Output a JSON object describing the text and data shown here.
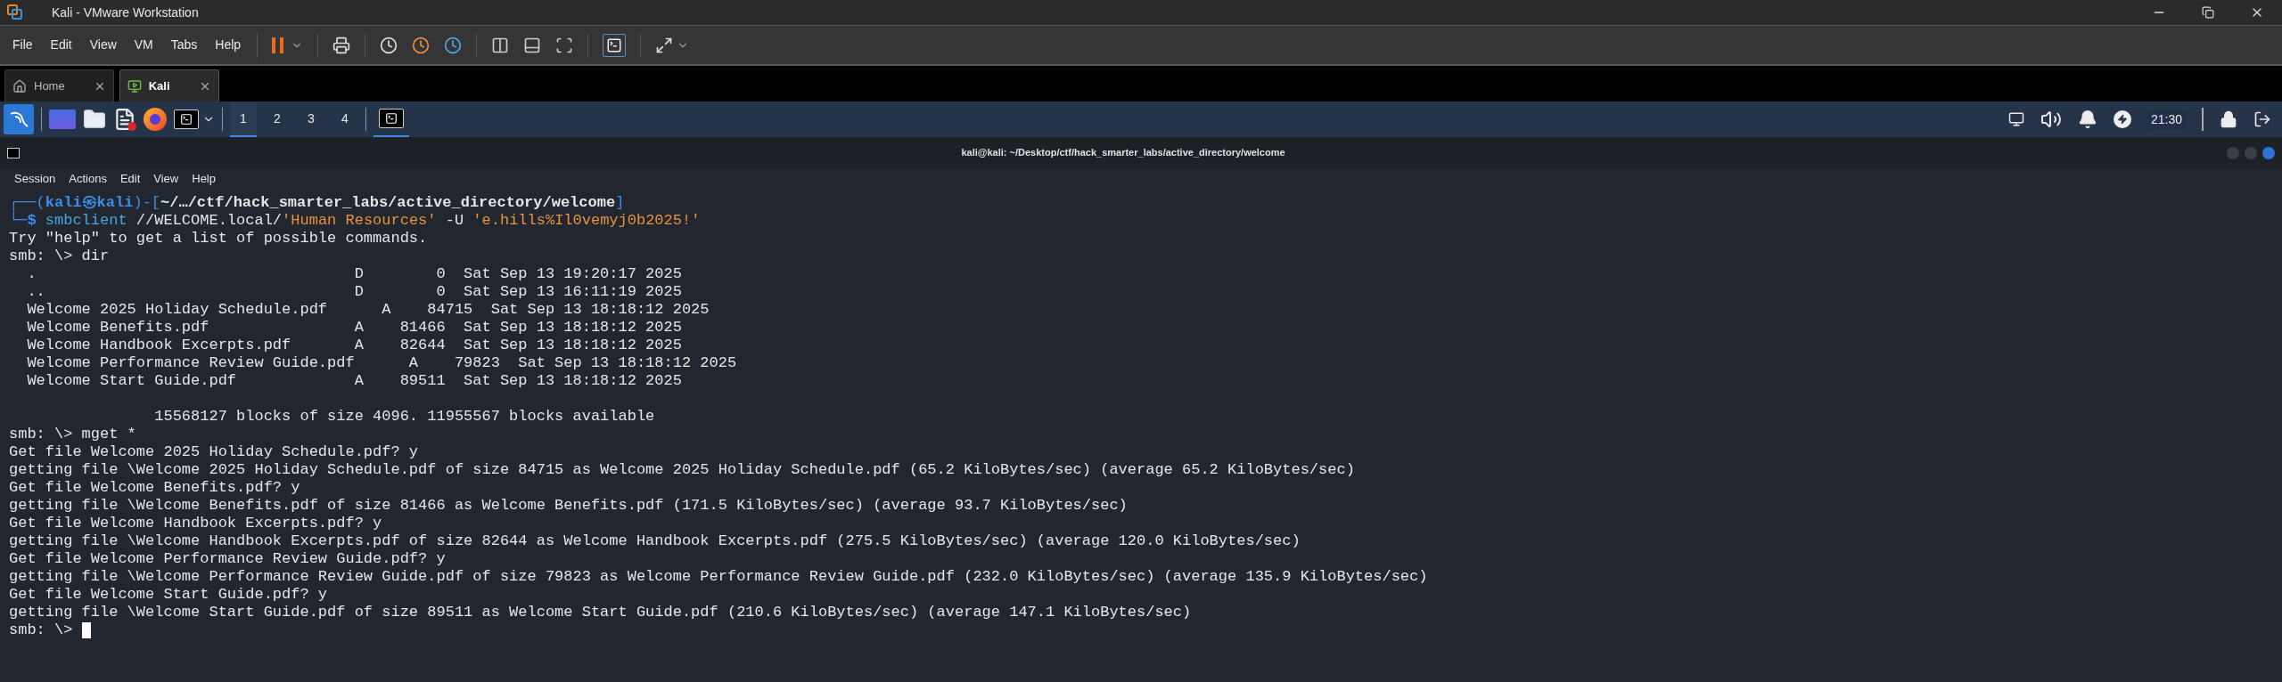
{
  "window": {
    "title": "Kali - VMware Workstation"
  },
  "menu": [
    "File",
    "Edit",
    "View",
    "VM",
    "Tabs",
    "Help"
  ],
  "vm_tabs": [
    {
      "label": "Home",
      "selected": false
    },
    {
      "label": "Kali",
      "selected": true
    }
  ],
  "panel": {
    "workspaces": [
      {
        "label": "1",
        "selected": true
      },
      {
        "label": "2",
        "selected": false
      },
      {
        "label": "3",
        "selected": false
      },
      {
        "label": "4",
        "selected": false
      }
    ],
    "clock": "21:30"
  },
  "terminal": {
    "title": "kali@kali: ~/Desktop/ctf/hack_smarter_labs/active_directory/welcome",
    "menu": [
      "Session",
      "Actions",
      "Edit",
      "View",
      "Help"
    ],
    "lines": [
      [
        {
          "kind": "frame",
          "text": "┌──("
        },
        {
          "kind": "user",
          "text": "kali㉿kali"
        },
        {
          "kind": "frame",
          "text": ")-["
        },
        {
          "kind": "path",
          "text": "~/…/ctf/hack_smarter_labs/active_directory/welcome"
        },
        {
          "kind": "frame",
          "text": "]"
        }
      ],
      [
        {
          "kind": "frame",
          "text": "└─"
        },
        {
          "kind": "user",
          "text": "$ "
        },
        {
          "kind": "command",
          "text": "smbclient"
        },
        {
          "kind": "plain",
          "text": " //WELCOME.local/"
        },
        {
          "kind": "string",
          "text": "'Human Resources'"
        },
        {
          "kind": "plain",
          "text": " -U "
        },
        {
          "kind": "string",
          "text": "'e.hills%Il0vemyj0b2025!'"
        }
      ],
      [
        {
          "kind": "plain",
          "text": "Try \"help\" to get a list of possible commands."
        }
      ],
      [
        {
          "kind": "plain",
          "text": "smb: \\> dir"
        }
      ],
      [
        {
          "kind": "plain",
          "text": "  .                                   D        0  Sat Sep 13 19:20:17 2025"
        }
      ],
      [
        {
          "kind": "plain",
          "text": "  ..                                  D        0  Sat Sep 13 16:11:19 2025"
        }
      ],
      [
        {
          "kind": "plain",
          "text": "  Welcome 2025 Holiday Schedule.pdf      A    84715  Sat Sep 13 18:18:12 2025"
        }
      ],
      [
        {
          "kind": "plain",
          "text": "  Welcome Benefits.pdf                A    81466  Sat Sep 13 18:18:12 2025"
        }
      ],
      [
        {
          "kind": "plain",
          "text": "  Welcome Handbook Excerpts.pdf       A    82644  Sat Sep 13 18:18:12 2025"
        }
      ],
      [
        {
          "kind": "plain",
          "text": "  Welcome Performance Review Guide.pdf      A    79823  Sat Sep 13 18:18:12 2025"
        }
      ],
      [
        {
          "kind": "plain",
          "text": "  Welcome Start Guide.pdf             A    89511  Sat Sep 13 18:18:12 2025"
        }
      ],
      [
        {
          "kind": "blank"
        }
      ],
      [
        {
          "kind": "plain",
          "text": "                15568127 blocks of size 4096. 11955567 blocks available"
        }
      ],
      [
        {
          "kind": "plain",
          "text": "smb: \\> mget *"
        }
      ],
      [
        {
          "kind": "plain",
          "text": "Get file Welcome 2025 Holiday Schedule.pdf? y"
        }
      ],
      [
        {
          "kind": "plain",
          "text": "getting file \\Welcome 2025 Holiday Schedule.pdf of size 84715 as Welcome 2025 Holiday Schedule.pdf (65.2 KiloBytes/sec) (average 65.2 KiloBytes/sec)"
        }
      ],
      [
        {
          "kind": "plain",
          "text": "Get file Welcome Benefits.pdf? y"
        }
      ],
      [
        {
          "kind": "plain",
          "text": "getting file \\Welcome Benefits.pdf of size 81466 as Welcome Benefits.pdf (171.5 KiloBytes/sec) (average 93.7 KiloBytes/sec)"
        }
      ],
      [
        {
          "kind": "plain",
          "text": "Get file Welcome Handbook Excerpts.pdf? y"
        }
      ],
      [
        {
          "kind": "plain",
          "text": "getting file \\Welcome Handbook Excerpts.pdf of size 82644 as Welcome Handbook Excerpts.pdf (275.5 KiloBytes/sec) (average 120.0 KiloBytes/sec)"
        }
      ],
      [
        {
          "kind": "plain",
          "text": "Get file Welcome Performance Review Guide.pdf? y"
        }
      ],
      [
        {
          "kind": "plain",
          "text": "getting file \\Welcome Performance Review Guide.pdf of size 79823 as Welcome Performance Review Guide.pdf (232.0 KiloBytes/sec) (average 135.9 KiloBytes/sec)"
        }
      ],
      [
        {
          "kind": "plain",
          "text": "Get file Welcome Start Guide.pdf? y"
        }
      ],
      [
        {
          "kind": "plain",
          "text": "getting file \\Welcome Start Guide.pdf of size 89511 as Welcome Start Guide.pdf (210.6 KiloBytes/sec) (average 147.1 KiloBytes/sec)"
        }
      ],
      [
        {
          "kind": "plain",
          "text": "smb: \\> "
        }
      ]
    ]
  }
}
